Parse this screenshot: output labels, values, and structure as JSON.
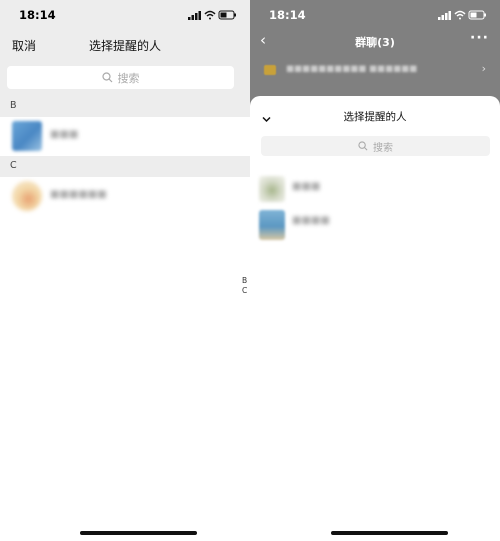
{
  "status": {
    "time_left": "18:14",
    "time_right": "18:14"
  },
  "left": {
    "cancel_label": "取消",
    "title": "选择提醒的人",
    "search_placeholder": "搜索",
    "sections": [
      {
        "letter": "B"
      },
      {
        "letter": "C"
      }
    ],
    "index": [
      "B",
      "C"
    ]
  },
  "right": {
    "chat_title": "群聊(3)",
    "more_label": "···",
    "sheet": {
      "title": "选择提醒的人",
      "search_placeholder": "搜索"
    }
  }
}
